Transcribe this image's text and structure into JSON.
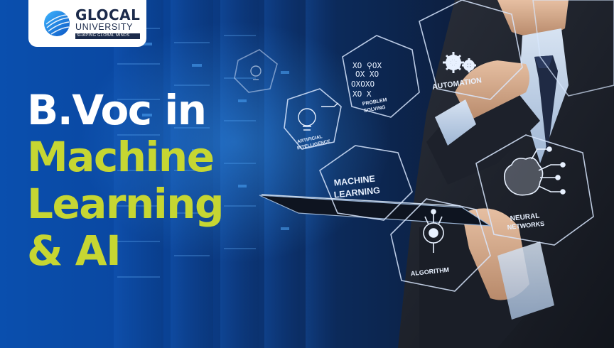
{
  "brand": {
    "name": "GLOCAL",
    "subtitle": "UNIVERSITY",
    "tagline": "SHAPING GLOBAL MINDS"
  },
  "headline": {
    "line1": "B.Voc in",
    "line2": "Machine",
    "line3": "Learning",
    "line4": "& AI"
  },
  "hex_labels": {
    "automation": "AUTOMATION",
    "problem_solving_1": "PROBLEM",
    "problem_solving_2": "SOLVING",
    "artificial_1": "ARTIFICIAL",
    "artificial_2": "INTELLIGENCE",
    "machine_learning_1": "MACHINE",
    "machine_learning_2": "LEARNING",
    "neural_1": "NEURAL",
    "neural_2": "NETWORKS",
    "algorithm": "ALGORITHM",
    "xo_row1": "XO  ⚲OX",
    "xo_row2": "OX   XO",
    "xo_row3": "OXOXO",
    "xo_row4": "XO   X"
  },
  "colors": {
    "accent": "#c6d632",
    "headline_white": "#ffffff",
    "brand_navy": "#1b2a4a",
    "background_blue": "#0a4fae"
  },
  "icons": [
    "globe-logo-icon",
    "gears-icon",
    "brain-circuit-icon",
    "algorithm-chip-icon",
    "lightbulb-icon",
    "tic-tac-toe-icon",
    "hand-tablet-icon"
  ]
}
